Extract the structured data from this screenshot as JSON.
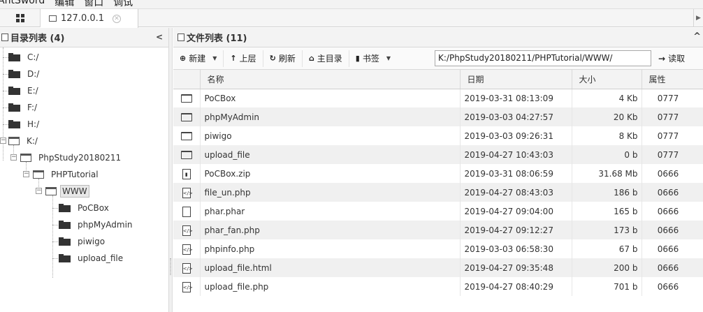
{
  "menu": {
    "items": [
      "AntSword",
      "编辑",
      "窗口",
      "调试"
    ]
  },
  "tabs": {
    "host_label": "127.0.0.1"
  },
  "dir_panel": {
    "title": "目录列表 (4)",
    "tree": [
      {
        "label": "C:/"
      },
      {
        "label": "D:/"
      },
      {
        "label": "E:/"
      },
      {
        "label": "F:/"
      },
      {
        "label": "H:/"
      },
      {
        "label": "K:/"
      },
      {
        "label": "PhpStudy20180211"
      },
      {
        "label": "PHPTutorial"
      },
      {
        "label": "WWW"
      },
      {
        "label": "PoCBox"
      },
      {
        "label": "phpMyAdmin"
      },
      {
        "label": "piwigo"
      },
      {
        "label": "upload_file"
      }
    ]
  },
  "file_panel": {
    "title": "文件列表 (11)",
    "toolbar": {
      "new": "新建",
      "up": "上层",
      "refresh": "刷新",
      "home": "主目录",
      "bookmark": "书签",
      "path": "K:/PhpStudy20180211/PHPTutorial/WWW/",
      "read": "读取"
    },
    "columns": {
      "name": "名称",
      "date": "日期",
      "size": "大小",
      "attr": "属性"
    },
    "rows": [
      {
        "icon": "folder-icon",
        "name": "PoCBox",
        "date": "2019-03-31 08:13:09",
        "size": "4 Kb",
        "attr": "0777"
      },
      {
        "icon": "folder-icon",
        "name": "phpMyAdmin",
        "date": "2019-03-03 04:27:57",
        "size": "20 Kb",
        "attr": "0777"
      },
      {
        "icon": "folder-icon",
        "name": "piwigo",
        "date": "2019-03-03 09:26:31",
        "size": "8 Kb",
        "attr": "0777"
      },
      {
        "icon": "folder-icon",
        "name": "upload_file",
        "date": "2019-04-27 10:43:03",
        "size": "0 b",
        "attr": "0777"
      },
      {
        "icon": "zip-file-icon",
        "name": "PoCBox.zip",
        "date": "2019-03-31 08:06:59",
        "size": "31.68 Mb",
        "attr": "0666"
      },
      {
        "icon": "code-file-icon",
        "name": "file_un.php",
        "date": "2019-04-27 08:43:03",
        "size": "186 b",
        "attr": "0666"
      },
      {
        "icon": "file-icon",
        "name": "phar.phar",
        "date": "2019-04-27 09:04:00",
        "size": "165 b",
        "attr": "0666"
      },
      {
        "icon": "code-file-icon",
        "name": "phar_fan.php",
        "date": "2019-04-27 09:12:27",
        "size": "173 b",
        "attr": "0666"
      },
      {
        "icon": "code-file-icon",
        "name": "phpinfo.php",
        "date": "2019-03-03 06:58:30",
        "size": "67 b",
        "attr": "0666"
      },
      {
        "icon": "code-file-icon",
        "name": "upload_file.html",
        "date": "2019-04-27 09:35:48",
        "size": "200 b",
        "attr": "0666"
      },
      {
        "icon": "code-file-icon",
        "name": "upload_file.php",
        "date": "2019-04-27 08:40:29",
        "size": "701 b",
        "attr": "0666"
      }
    ]
  }
}
